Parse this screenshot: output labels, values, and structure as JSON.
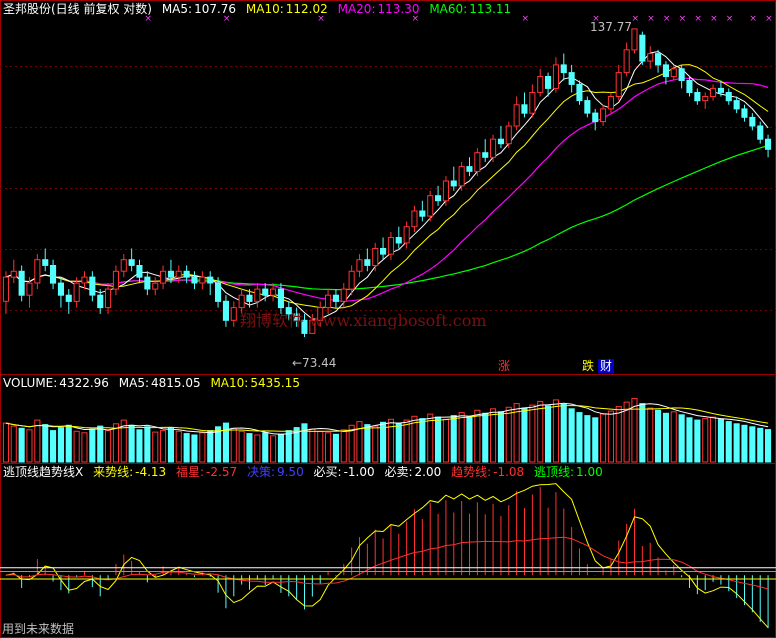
{
  "header": {
    "stock": "圣邦股份(日线 前复权 对数)",
    "ma5": {
      "label": "MA5:",
      "value": "107.76",
      "color": "#ffffff"
    },
    "ma10": {
      "label": "MA10:",
      "value": "112.02",
      "color": "#ffff00"
    },
    "ma20": {
      "label": "MA20:",
      "value": "113.30",
      "color": "#ff00ff"
    },
    "ma60": {
      "label": "MA60:",
      "value": "113.11",
      "color": "#00ff00"
    }
  },
  "price_panel": {
    "high_marker": "137.77",
    "low_marker": "←73.44",
    "signals": [
      {
        "text": "涨",
        "color": "#ff3030",
        "bg": "#000000"
      },
      {
        "text": "跌",
        "color": "#ffff00",
        "bg": "#000000"
      },
      {
        "text": "财",
        "color": "#ffffff",
        "bg": "#0000c0"
      }
    ],
    "watermark": "翔博软件 www.xiangbosoft.com"
  },
  "volume_panel": {
    "volume": {
      "label": "VOLUME:",
      "value": "4322.96",
      "color": "#ffffff"
    },
    "ma5": {
      "label": "MA5:",
      "value": "4815.05",
      "color": "#ffffff"
    },
    "ma10": {
      "label": "MA10:",
      "value": "5435.15",
      "color": "#ffff00"
    }
  },
  "indicator_panel": {
    "name": "逃顶线趋势线X",
    "items": [
      {
        "label": "来势线:",
        "value": "-4.13",
        "color": "#ffff00"
      },
      {
        "label": "福星:",
        "value": "-2.57",
        "color": "#ff3030"
      },
      {
        "label": "决策:",
        "value": "9.50",
        "color": "#4040ff"
      },
      {
        "label": "必买:",
        "value": "-1.00",
        "color": "#ffffff"
      },
      {
        "label": "必卖:",
        "value": "2.00",
        "color": "#ffffff"
      },
      {
        "label": "趋势线:",
        "value": "-1.08",
        "color": "#ff3030"
      },
      {
        "label": "逃顶线:",
        "value": "1.00",
        "color": "#00ff00"
      }
    ]
  },
  "footer": {
    "text": "用到未来数据"
  },
  "colors": {
    "up": "#ff3232",
    "down": "#54ffff",
    "ma5": "#ffffff",
    "ma10": "#ffff00",
    "ma20": "#ff00ff",
    "ma60": "#00ff00",
    "frame": "#a00000"
  },
  "chart_data": {
    "type": "candlestick",
    "price_scale": "log",
    "ylim": [
      73.44,
      137.77
    ],
    "candles": [
      [
        79,
        83,
        84,
        77
      ],
      [
        83,
        84,
        86,
        82
      ],
      [
        84,
        80,
        85,
        79
      ],
      [
        80,
        82,
        83,
        78
      ],
      [
        82,
        86,
        87,
        81
      ],
      [
        86,
        85,
        88,
        84
      ],
      [
        85,
        82,
        86,
        81
      ],
      [
        82,
        80,
        83,
        78
      ],
      [
        80,
        79,
        81,
        77
      ],
      [
        79,
        82,
        83,
        78
      ],
      [
        82,
        83,
        84,
        81
      ],
      [
        83,
        80,
        84,
        79
      ],
      [
        80,
        78,
        81,
        77
      ],
      [
        78,
        81,
        82,
        77
      ],
      [
        81,
        84,
        85,
        80
      ],
      [
        84,
        86,
        87,
        83
      ],
      [
        86,
        85,
        88,
        84
      ],
      [
        85,
        83,
        86,
        82
      ],
      [
        83,
        81,
        84,
        80
      ],
      [
        81,
        82,
        83,
        80
      ],
      [
        82,
        84,
        85,
        81
      ],
      [
        84,
        83,
        86,
        82
      ],
      [
        83,
        84,
        85,
        82
      ],
      [
        84,
        83,
        85,
        82
      ],
      [
        83,
        82,
        84,
        81
      ],
      [
        82,
        83,
        84,
        81
      ],
      [
        83,
        82,
        84,
        80
      ],
      [
        82,
        79,
        83,
        78
      ],
      [
        79,
        76,
        80,
        75
      ],
      [
        76,
        78,
        79,
        75
      ],
      [
        78,
        80,
        81,
        77
      ],
      [
        80,
        79,
        81,
        78
      ],
      [
        79,
        81,
        82,
        78
      ],
      [
        81,
        80,
        82,
        79
      ],
      [
        80,
        81,
        82,
        79
      ],
      [
        81,
        78,
        82,
        77
      ],
      [
        78,
        77,
        79,
        76
      ],
      [
        77,
        76,
        78,
        75
      ],
      [
        76,
        74,
        77,
        73.44
      ],
      [
        74,
        76,
        77,
        74
      ],
      [
        76,
        78,
        79,
        75
      ],
      [
        78,
        80,
        81,
        77
      ],
      [
        80,
        79,
        81,
        78
      ],
      [
        79,
        81,
        82,
        78
      ],
      [
        81,
        84,
        85,
        80
      ],
      [
        84,
        86,
        87,
        83
      ],
      [
        86,
        85,
        88,
        84
      ],
      [
        85,
        88,
        89,
        84
      ],
      [
        88,
        87,
        90,
        86
      ],
      [
        87,
        90,
        91,
        86
      ],
      [
        90,
        89,
        92,
        88
      ],
      [
        89,
        92,
        93,
        88
      ],
      [
        92,
        95,
        96,
        91
      ],
      [
        95,
        94,
        97,
        93
      ],
      [
        94,
        98,
        99,
        93
      ],
      [
        98,
        97,
        100,
        96
      ],
      [
        97,
        101,
        102,
        96
      ],
      [
        101,
        100,
        104,
        99
      ],
      [
        100,
        104,
        105,
        99
      ],
      [
        104,
        103,
        106,
        102
      ],
      [
        103,
        107,
        108,
        102
      ],
      [
        107,
        106,
        110,
        105
      ],
      [
        106,
        110,
        111,
        105
      ],
      [
        110,
        109,
        113,
        108
      ],
      [
        109,
        113,
        114,
        108
      ],
      [
        113,
        118,
        120,
        112
      ],
      [
        118,
        116,
        121,
        115
      ],
      [
        116,
        121,
        123,
        115
      ],
      [
        121,
        125,
        127,
        120
      ],
      [
        125,
        122,
        126,
        120
      ],
      [
        122,
        128,
        130,
        121
      ],
      [
        128,
        126,
        131,
        124
      ],
      [
        126,
        123,
        128,
        121
      ],
      [
        123,
        119,
        124,
        118
      ],
      [
        119,
        116,
        120,
        115
      ],
      [
        116,
        114,
        117,
        112
      ],
      [
        114,
        117,
        118,
        113
      ],
      [
        117,
        120,
        121,
        116
      ],
      [
        120,
        126,
        128,
        119
      ],
      [
        126,
        132,
        134,
        125
      ],
      [
        132,
        137.77,
        137.77,
        131
      ],
      [
        136,
        129,
        137,
        128
      ],
      [
        129,
        131,
        133,
        127
      ],
      [
        131,
        128,
        132,
        126
      ],
      [
        128,
        125,
        129,
        123
      ],
      [
        125,
        127,
        128,
        124
      ],
      [
        127,
        124,
        128,
        122
      ],
      [
        124,
        121,
        125,
        120
      ],
      [
        121,
        119,
        122,
        118
      ],
      [
        119,
        120,
        121,
        117
      ],
      [
        120,
        122,
        123,
        119
      ],
      [
        122,
        121,
        124,
        120
      ],
      [
        121,
        119,
        122,
        118
      ],
      [
        119,
        117,
        120,
        116
      ],
      [
        117,
        115,
        118,
        114
      ],
      [
        115,
        113,
        116,
        112
      ],
      [
        113,
        110,
        114,
        109
      ],
      [
        110,
        107.76,
        111,
        106
      ]
    ],
    "volume": [
      5200,
      4800,
      4500,
      4300,
      5600,
      5000,
      4200,
      4600,
      4900,
      4100,
      3900,
      4400,
      4800,
      4200,
      5100,
      5600,
      4900,
      4300,
      4700,
      4000,
      4200,
      4600,
      4100,
      3800,
      3600,
      3900,
      4200,
      4700,
      5200,
      4500,
      4100,
      3800,
      3600,
      3900,
      3500,
      3700,
      4200,
      4600,
      5100,
      4400,
      4100,
      3900,
      3700,
      4300,
      4900,
      5400,
      5000,
      4800,
      5300,
      5700,
      5200,
      5600,
      6100,
      5800,
      6400,
      6000,
      5700,
      6200,
      6600,
      6100,
      6900,
      6500,
      7100,
      6700,
      7300,
      7800,
      7200,
      7600,
      8100,
      7500,
      8300,
      7700,
      7100,
      6600,
      6200,
      5900,
      6400,
      6800,
      7400,
      8000,
      8500,
      7800,
      7200,
      6900,
      6500,
      6700,
      6300,
      5900,
      5600,
      5800,
      6000,
      5700,
      5400,
      5100,
      4900,
      4700,
      4500,
      4322.96
    ],
    "indicator_range": [
      -12,
      25
    ]
  }
}
